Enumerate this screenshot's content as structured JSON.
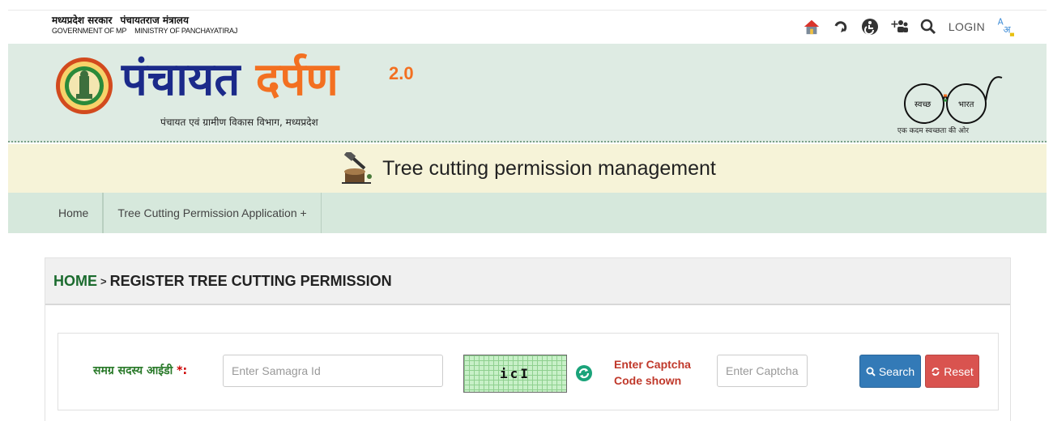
{
  "gov": {
    "state_hi": "मध्यप्रदेश सरकार",
    "state_en": "GOVERNMENT OF MP",
    "ministry_hi": "पंचायतराज मंत्रालय",
    "ministry_en": "MINISTRY OF PANCHAYATIRAJ"
  },
  "top_icons": [
    "home-icon",
    "undo-icon",
    "accessibility-icon",
    "users-icon",
    "search-icon"
  ],
  "login_label": "LOGIN",
  "brand": {
    "part1": "पंचायत",
    "part2": "दर्पण",
    "version": "2.0",
    "subtitle": "पंचायत एवं ग्रामीण विकास विभाग, मध्यप्रदेश",
    "swachh_left": "स्वच्छ",
    "swachh_right": "भारत",
    "swachh_tag": "एक कदम स्वच्छता की ओर"
  },
  "page_title": "Tree cutting permission management",
  "nav": {
    "home": "Home",
    "tree_app": "Tree Cutting Permission Application +"
  },
  "breadcrumb": {
    "home": "HOME",
    "separator": ">",
    "current": "REGISTER TREE CUTTING PERMISSION"
  },
  "form": {
    "samagra_label": "समग्र सदस्य आईडी",
    "required_mark": "*:",
    "samagra_placeholder": "Enter Samagra Id",
    "captcha_text": "icI",
    "captcha_label": "Enter Captcha Code shown",
    "captcha_placeholder": "Enter Captcha",
    "search_label": "Search",
    "reset_label": "Reset"
  },
  "colors": {
    "banner_bg": "#deebe3",
    "title_bg": "#f6f3d8",
    "nav_bg": "#d6e8dc",
    "brand_blue": "#1b2a8a",
    "brand_orange": "#f37021",
    "search_btn": "#337ab7",
    "reset_btn": "#d9534f"
  }
}
